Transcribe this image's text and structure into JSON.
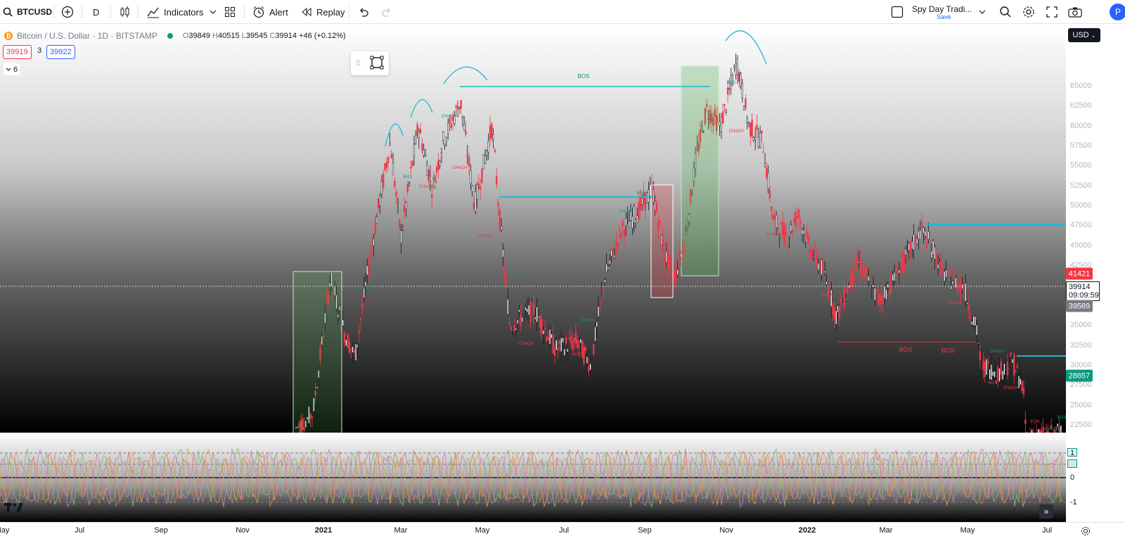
{
  "toolbar": {
    "symbol": "BTCUSD",
    "interval": "D",
    "indicators_label": "Indicators",
    "alert_label": "Alert",
    "replay_label": "Replay",
    "layout_name": "Spy Day Tradi...",
    "layout_sub": "Save",
    "avatar_letter": "P"
  },
  "legend": {
    "title": "Bitcoin / U.S. Dollar · 1D · BITSTAMP",
    "open_label": "O",
    "open": "39849",
    "high_label": "H",
    "high": "40515",
    "low_label": "L",
    "low": "39545",
    "close_label": "C",
    "close": "39914",
    "change": "+46 (+0.12%)",
    "bid": "39919",
    "spread": "3",
    "ask": "39922",
    "indicator_count": "6"
  },
  "price_axis": {
    "currency": "USD",
    "ticks": [
      "65000",
      "62500",
      "60000",
      "57500",
      "55000",
      "52500",
      "50000",
      "47500",
      "45000",
      "42500",
      "40000",
      "37500",
      "35000",
      "32500",
      "30000",
      "27500",
      "25000",
      "22500"
    ],
    "labels": {
      "high_line": "41421",
      "last": "39914",
      "countdown": "09:09:59",
      "low_line": "39589",
      "level": "28657"
    }
  },
  "osc_axis": {
    "ticks": [
      "1",
      "0",
      "-1"
    ]
  },
  "time_axis": {
    "ticks": [
      "May",
      "Jul",
      "Sep",
      "Nov",
      "2021",
      "Mar",
      "May",
      "Jul",
      "Sep",
      "Nov",
      "2022",
      "Mar",
      "May",
      "Jul"
    ]
  },
  "chart_data": {
    "type": "candlestick",
    "annotations": [
      "BOS",
      "BOS",
      "CHoCH",
      "CHoCH",
      "CHoCH",
      "BOS",
      "CHoCH",
      "CHoCH",
      "BOS",
      "CHoCH",
      "BOS",
      "CHoCH",
      "CHoCH",
      "BOS",
      "CHoCH",
      "BOS",
      "CHoCH",
      "BOS",
      "CHoCH",
      "BOS",
      "CHoCH",
      "BOS",
      "CHoCH",
      "EQH",
      "CHoCH",
      "BOS",
      "CHoCH"
    ],
    "ylim": [
      20500,
      70000
    ],
    "colors": {
      "up": "#131722",
      "down": "#f23645",
      "bos_line": "#22b8cf",
      "choch_line": "#c2302f"
    },
    "levels": [
      65000,
      51000,
      47500,
      33000,
      31000
    ],
    "key_prices": [
      41421,
      39914,
      39589,
      28657
    ]
  }
}
